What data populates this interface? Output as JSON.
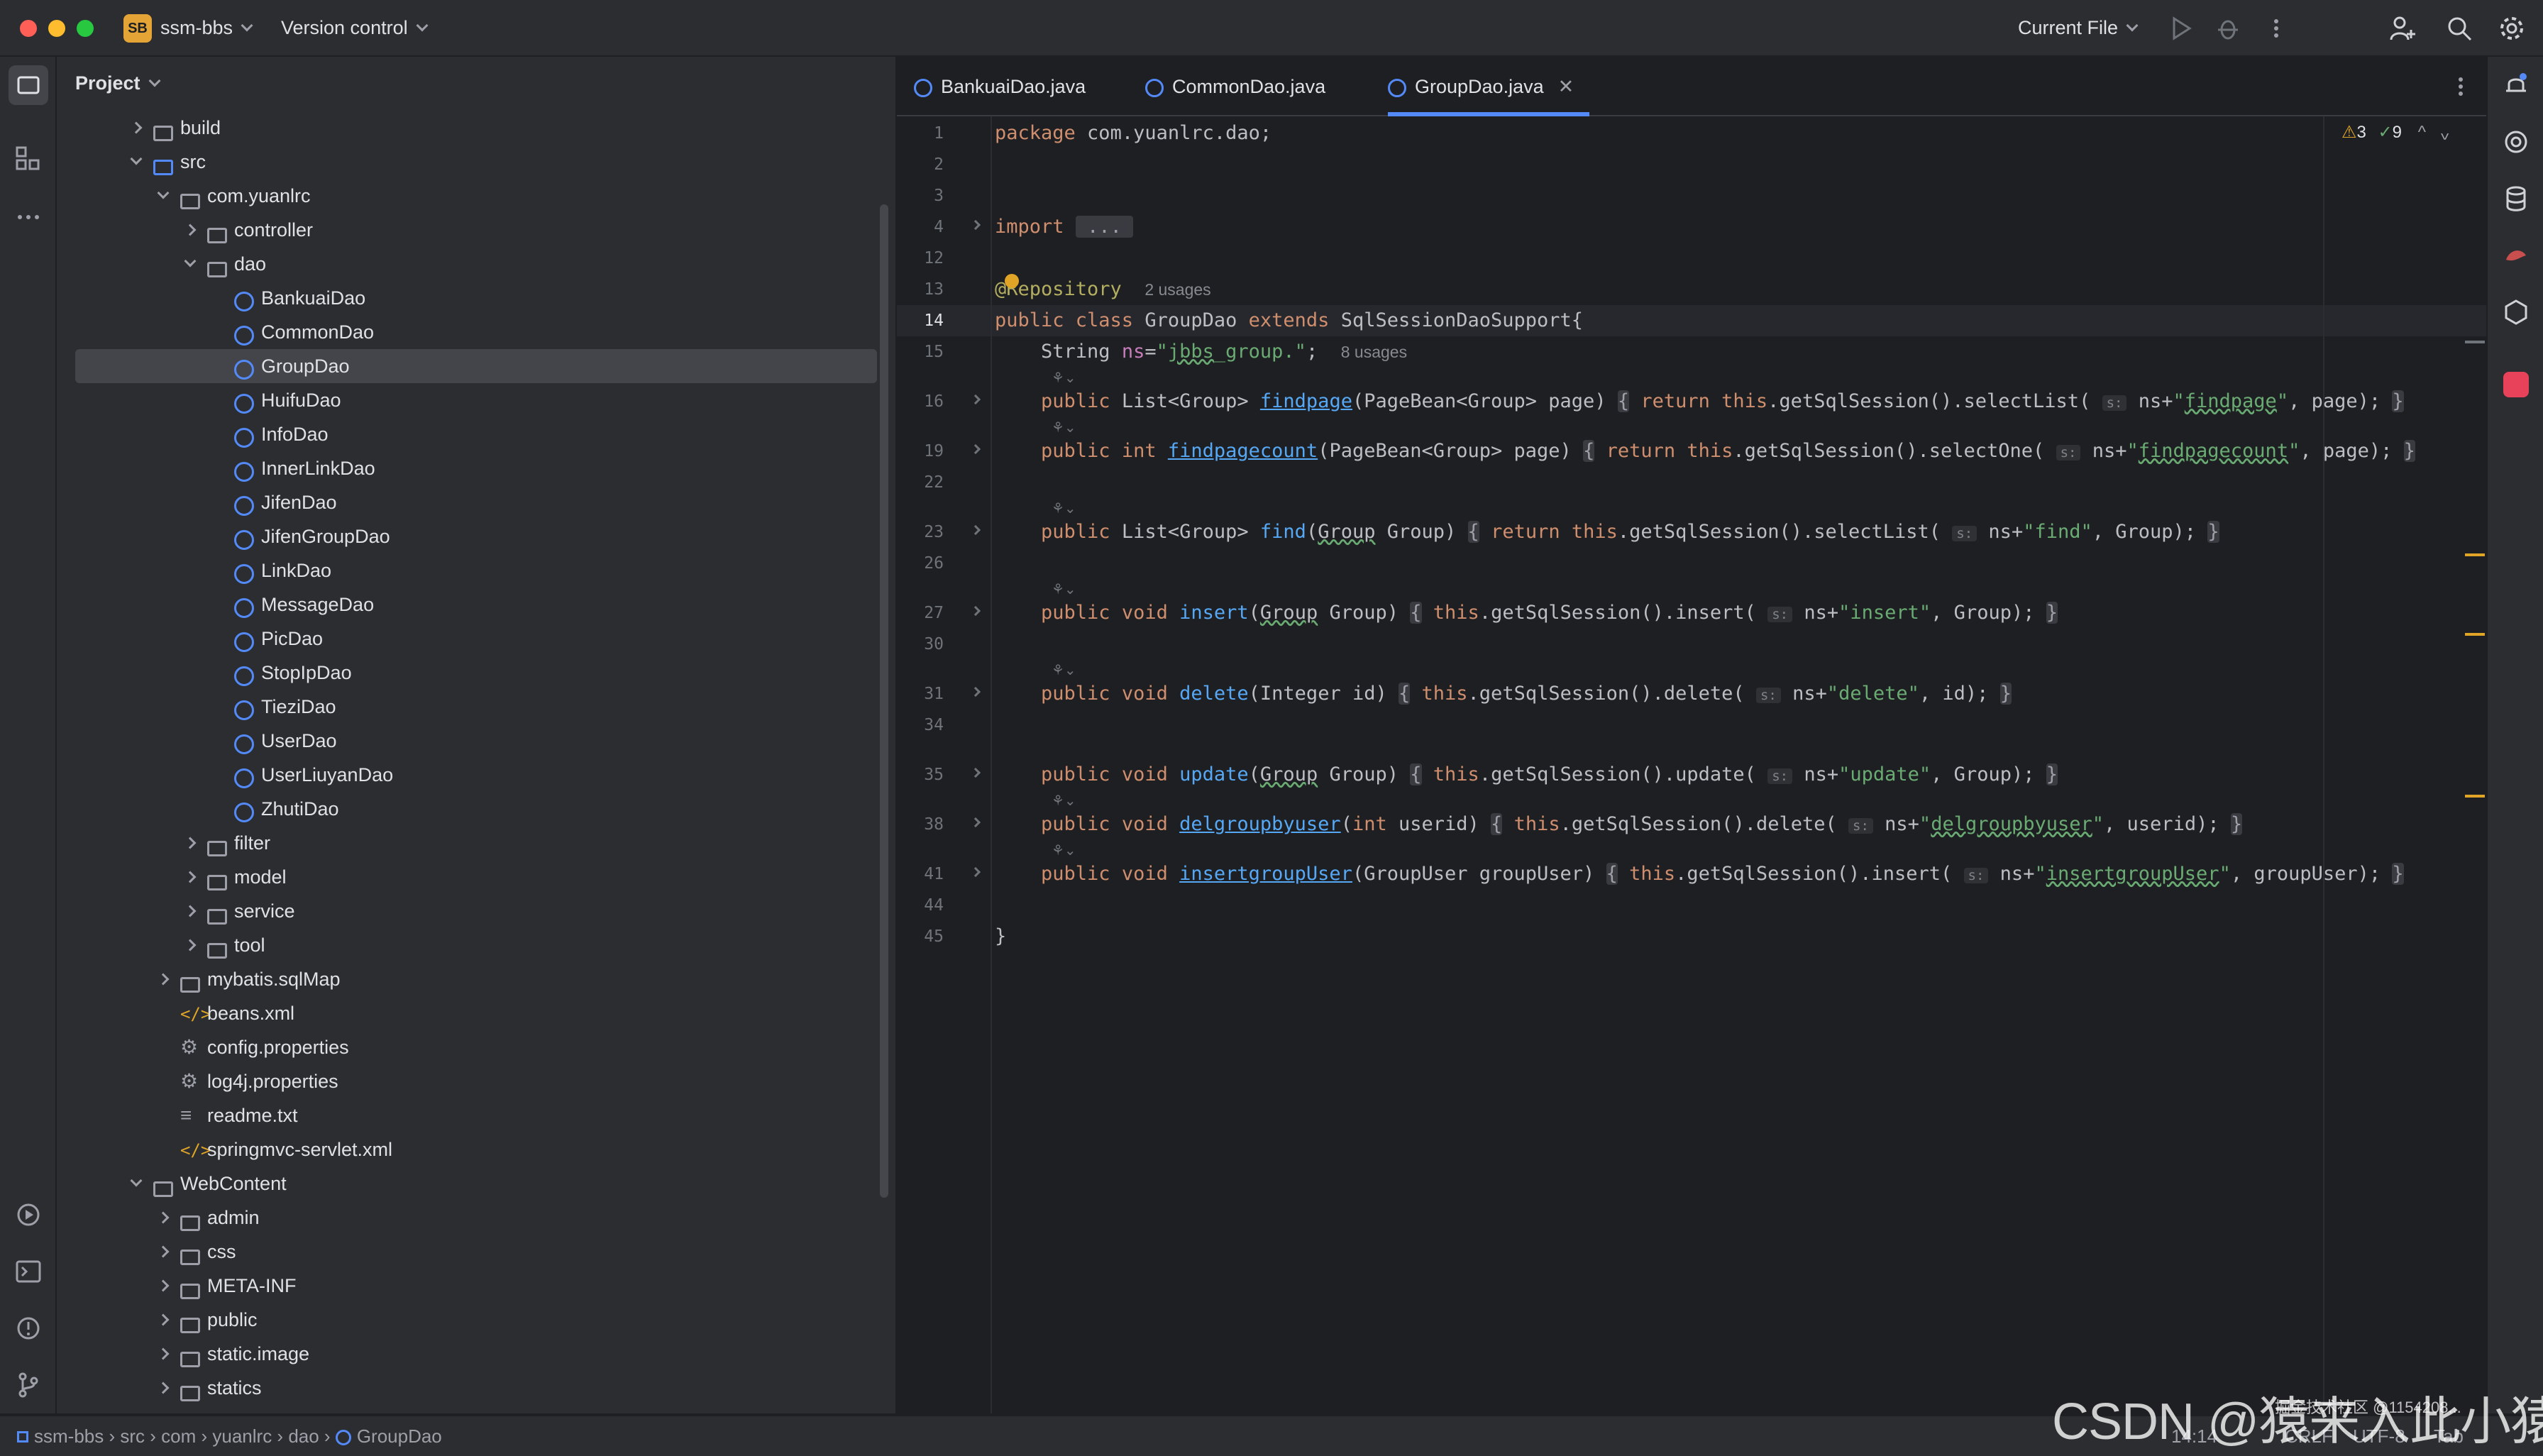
{
  "titlebar": {
    "project_badge": "SB",
    "project_name": "ssm-bbs",
    "vcs": "Version control",
    "run_config": "Current File"
  },
  "project_panel": {
    "title": "Project",
    "tree": [
      {
        "label": "build",
        "depth": 1,
        "type": "folder",
        "expanded": false
      },
      {
        "label": "src",
        "depth": 1,
        "type": "src-folder",
        "expanded": true
      },
      {
        "label": "com.yuanlrc",
        "depth": 2,
        "type": "package",
        "expanded": true
      },
      {
        "label": "controller",
        "depth": 3,
        "type": "package",
        "expanded": false
      },
      {
        "label": "dao",
        "depth": 3,
        "type": "package",
        "expanded": true
      },
      {
        "label": "BankuaiDao",
        "depth": 4,
        "type": "class"
      },
      {
        "label": "CommonDao",
        "depth": 4,
        "type": "class"
      },
      {
        "label": "GroupDao",
        "depth": 4,
        "type": "class",
        "selected": true
      },
      {
        "label": "HuifuDao",
        "depth": 4,
        "type": "class"
      },
      {
        "label": "InfoDao",
        "depth": 4,
        "type": "class"
      },
      {
        "label": "InnerLinkDao",
        "depth": 4,
        "type": "class"
      },
      {
        "label": "JifenDao",
        "depth": 4,
        "type": "class"
      },
      {
        "label": "JifenGroupDao",
        "depth": 4,
        "type": "class"
      },
      {
        "label": "LinkDao",
        "depth": 4,
        "type": "class"
      },
      {
        "label": "MessageDao",
        "depth": 4,
        "type": "class"
      },
      {
        "label": "PicDao",
        "depth": 4,
        "type": "class"
      },
      {
        "label": "StopIpDao",
        "depth": 4,
        "type": "class"
      },
      {
        "label": "TieziDao",
        "depth": 4,
        "type": "class"
      },
      {
        "label": "UserDao",
        "depth": 4,
        "type": "class"
      },
      {
        "label": "UserLiuyanDao",
        "depth": 4,
        "type": "class"
      },
      {
        "label": "ZhutiDao",
        "depth": 4,
        "type": "class"
      },
      {
        "label": "filter",
        "depth": 3,
        "type": "package",
        "expanded": false
      },
      {
        "label": "model",
        "depth": 3,
        "type": "package",
        "expanded": false
      },
      {
        "label": "service",
        "depth": 3,
        "type": "package",
        "expanded": false
      },
      {
        "label": "tool",
        "depth": 3,
        "type": "package",
        "expanded": false
      },
      {
        "label": "mybatis.sqlMap",
        "depth": 2,
        "type": "package",
        "expanded": false
      },
      {
        "label": "beans.xml",
        "depth": 2,
        "type": "xml"
      },
      {
        "label": "config.properties",
        "depth": 2,
        "type": "props"
      },
      {
        "label": "log4j.properties",
        "depth": 2,
        "type": "props"
      },
      {
        "label": "readme.txt",
        "depth": 2,
        "type": "txt"
      },
      {
        "label": "springmvc-servlet.xml",
        "depth": 2,
        "type": "xml"
      },
      {
        "label": "WebContent",
        "depth": 1,
        "type": "web-folder",
        "expanded": true
      },
      {
        "label": "admin",
        "depth": 2,
        "type": "folder",
        "expanded": false
      },
      {
        "label": "css",
        "depth": 2,
        "type": "folder",
        "expanded": false
      },
      {
        "label": "META-INF",
        "depth": 2,
        "type": "folder",
        "expanded": false
      },
      {
        "label": "public",
        "depth": 2,
        "type": "folder",
        "expanded": false
      },
      {
        "label": "static.image",
        "depth": 2,
        "type": "folder",
        "expanded": false
      },
      {
        "label": "statics",
        "depth": 2,
        "type": "folder",
        "expanded": false
      }
    ]
  },
  "tabs": [
    {
      "label": "BankuaiDao.java",
      "active": false
    },
    {
      "label": "CommonDao.java",
      "active": false
    },
    {
      "label": "GroupDao.java",
      "active": true
    }
  ],
  "inspections": {
    "warnings": "3",
    "ok": "9"
  },
  "editor": {
    "current_line": "14",
    "lines": [
      {
        "n": "1",
        "html": "<span class=\"kw\">package</span> com.yuanlrc.dao;"
      },
      {
        "n": "2",
        "html": ""
      },
      {
        "n": "3",
        "html": ""
      },
      {
        "n": "4",
        "html": "<span class=\"kw\">import</span> <span class=\"fold\"> ... </span>",
        "fold": true
      },
      {
        "n": "12",
        "html": ""
      },
      {
        "n": "13",
        "html": "<span class=\"ann\">@Repository</span>  <span class=\"hint\">2 usages</span>"
      },
      {
        "n": "14",
        "html": "<span class=\"kw\">public class</span> GroupDao <span class=\"kw\">extends</span> SqlSessionDaoSupport{",
        "current": true
      },
      {
        "n": "15",
        "html": "    String <span class=\"str\" style=\"color:#c77dbb\">ns</span>=<span class=\"str\">\"<span class=\"wavy\">jbbs</span>_group.\"</span>;  <span class=\"hint\">8 usages</span>"
      },
      {
        "n": "16",
        "html": "    <span class=\"kw\">public</span> List&lt;Group&gt; <span class=\"fn ul\">findpage</span>(PageBean&lt;Group&gt; page) <span class=\"fold\">{</span> <span class=\"kw\">return this</span>.getSqlSession().selectList( <span class=\"param\">s:</span> ns+<span class=\"str\">\"<span class=\"wavy\">findpage</span>\"</span>, page); <span class=\"fold\">}</span>",
        "fold": true
      },
      {
        "n": "19",
        "html": "    <span class=\"kw\">public int</span> <span class=\"fn ul\">findpagecount</span>(PageBean&lt;Group&gt; page) <span class=\"fold\">{</span> <span class=\"kw\">return this</span>.getSqlSession().selectOne( <span class=\"param\">s:</span> ns+<span class=\"str\">\"<span class=\"wavy\">findpagecount</span>\"</span>, page); <span class=\"fold\">}</span>",
        "fold": true
      },
      {
        "n": "22",
        "html": ""
      },
      {
        "n": "23",
        "html": "    <span class=\"kw\">public</span> List&lt;Group&gt; <span class=\"fn\">find</span>(<span class=\"wavy\">Group</span> Group) <span class=\"fold\">{</span> <span class=\"kw\">return this</span>.getSqlSession().selectList( <span class=\"param\">s:</span> ns+<span class=\"str\">\"find\"</span>, Group); <span class=\"fold\">}</span>",
        "fold": true
      },
      {
        "n": "26",
        "html": ""
      },
      {
        "n": "27",
        "html": "    <span class=\"kw\">public void</span> <span class=\"fn\">insert</span>(<span class=\"wavy\">Group</span> Group) <span class=\"fold\">{</span> <span class=\"kw\">this</span>.getSqlSession().insert( <span class=\"param\">s:</span> ns+<span class=\"str\">\"insert\"</span>, Group); <span class=\"fold\">}</span>",
        "fold": true
      },
      {
        "n": "30",
        "html": ""
      },
      {
        "n": "31",
        "html": "    <span class=\"kw\">public void</span> <span class=\"fn\">delete</span>(Integer id) <span class=\"fold\">{</span> <span class=\"kw\">this</span>.getSqlSession().delete( <span class=\"param\">s:</span> ns+<span class=\"str\">\"delete\"</span>, id); <span class=\"fold\">}</span>",
        "fold": true
      },
      {
        "n": "34",
        "html": ""
      },
      {
        "n": "35",
        "html": "    <span class=\"kw\">public void</span> <span class=\"fn\">update</span>(<span class=\"wavy\">Group</span> Group) <span class=\"fold\">{</span> <span class=\"kw\">this</span>.getSqlSession().update( <span class=\"param\">s:</span> ns+<span class=\"str\">\"update\"</span>, Group); <span class=\"fold\">}</span>",
        "fold": true
      },
      {
        "n": "38",
        "html": "    <span class=\"kw\">public void</span> <span class=\"fn ul\">delgroupbyuser</span>(<span class=\"kw\">int</span> userid) <span class=\"fold\">{</span> <span class=\"kw\">this</span>.getSqlSession().delete( <span class=\"param\">s:</span> ns+<span class=\"str\">\"<span class=\"wavy\">delgroupbyuser</span>\"</span>, userid); <span class=\"fold\">}</span>",
        "fold": true
      },
      {
        "n": "41",
        "html": "    <span class=\"kw\">public void</span> <span class=\"fn ul\">insertgroupUser</span>(GroupUser groupUser) <span class=\"fold\">{</span> <span class=\"kw\">this</span>.getSqlSession().insert( <span class=\"param\">s:</span> ns+<span class=\"str\">\"<span class=\"wavy\">insertgroupUser</span>\"</span>, groupUser); <span class=\"fold\">}</span>",
        "fold": true
      },
      {
        "n": "44",
        "html": ""
      },
      {
        "n": "45",
        "html": "}"
      }
    ]
  },
  "breadcrumb": [
    "ssm-bbs",
    "src",
    "com",
    "yuanlrc",
    "dao",
    "GroupDao"
  ],
  "status": {
    "position": "14:14",
    "line_sep": "CRLF",
    "encoding": "UTF-8",
    "indent": "Tab"
  },
  "watermark": "CSDN @猿来入此小猿",
  "watermark_small": "掘金技术社区 @1154208...",
  "colors": {
    "accent": "#548af7",
    "keyword": "#cf8e6d",
    "function": "#56a8f5",
    "string": "#6aab73",
    "annotation": "#b3ae60",
    "warning": "#e0a526"
  }
}
